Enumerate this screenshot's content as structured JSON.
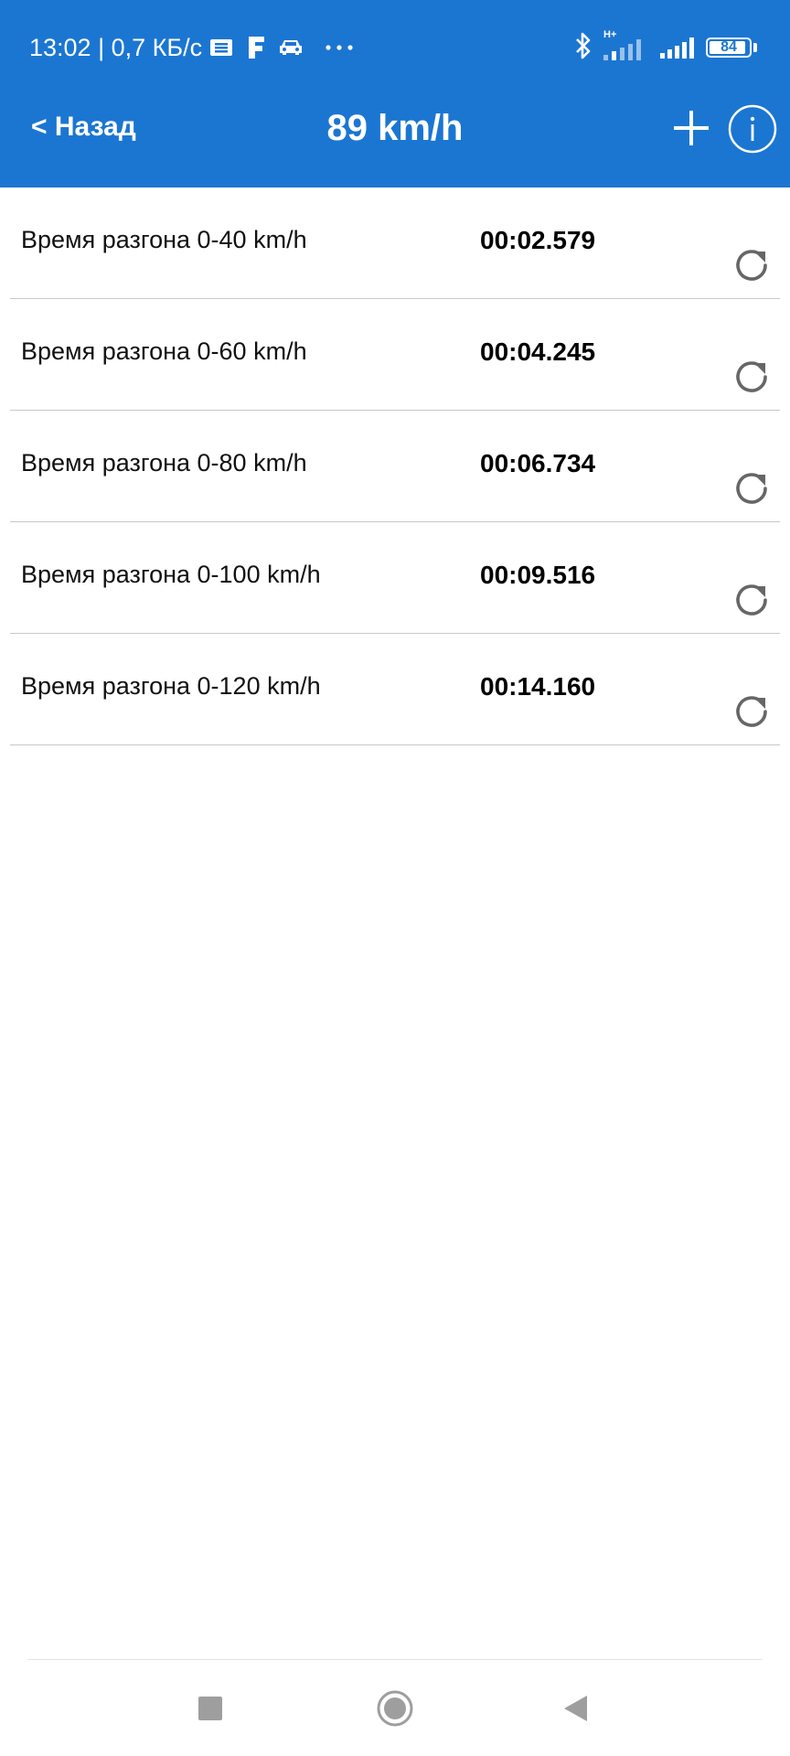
{
  "status_bar": {
    "time_speed": "13:02 | 0,7 КБ/с",
    "icons": [
      "notification-list-icon",
      "f-app-icon",
      "car-icon",
      "more-dots-icon",
      "bluetooth-icon",
      "signal-hplus-icon",
      "signal-icon",
      "battery-icon"
    ],
    "network_label": "H+",
    "battery_level": "84"
  },
  "app_bar": {
    "back_label": "< Назад",
    "title": "89 km/h",
    "add_icon": "plus-icon",
    "info_icon": "info-icon"
  },
  "list": {
    "items": [
      {
        "label": "Время разгона  0-40 km/h",
        "time": "00:02.579",
        "action_icon": "refresh-icon"
      },
      {
        "label": "Время разгона  0-60 km/h",
        "time": "00:04.245",
        "action_icon": "refresh-icon"
      },
      {
        "label": "Время разгона  0-80 km/h",
        "time": "00:06.734",
        "action_icon": "refresh-icon"
      },
      {
        "label": "Время разгона  0-100 km/h",
        "time": "00:09.516",
        "action_icon": "refresh-icon"
      },
      {
        "label": "Время разгона  0-120 km/h",
        "time": "00:14.160",
        "action_icon": "refresh-icon"
      }
    ]
  },
  "nav_bar": {
    "icons": [
      "recents-square-icon",
      "home-circle-icon",
      "back-triangle-icon"
    ]
  },
  "colors": {
    "header_bg": "#1b76d2",
    "divider": "#c8c8c8",
    "icon_gray": "#666666"
  }
}
